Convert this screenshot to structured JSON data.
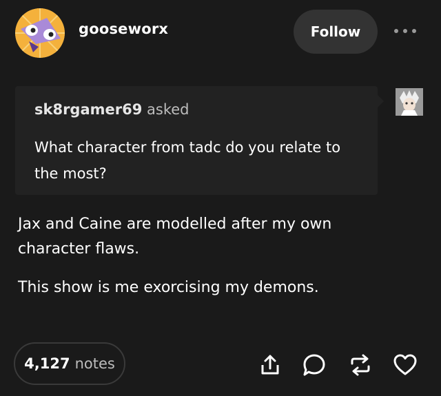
{
  "post": {
    "author": "gooseworx",
    "follow_label": "Follow",
    "ask": {
      "asker": "sk8rgamer69",
      "asked_word": "asked",
      "question": "What character from tadc do you relate to the most?"
    },
    "answer": [
      "Jax and Caine are modelled after my own character flaws.",
      "This show is me exorcising my demons."
    ],
    "notes": {
      "count": "4,127",
      "label": "notes"
    }
  },
  "icons": {
    "more": "more-horizontal-icon",
    "share": "share-icon",
    "reply": "reply-bubble-icon",
    "reblog": "reblog-icon",
    "like": "heart-icon"
  },
  "colors": {
    "background": "#1a1a1a",
    "ask_box": "#222222",
    "button": "#333333",
    "text": "#ffffff",
    "muted_text": "#bdbdbd",
    "avatar_bg": "#f4b13c"
  }
}
